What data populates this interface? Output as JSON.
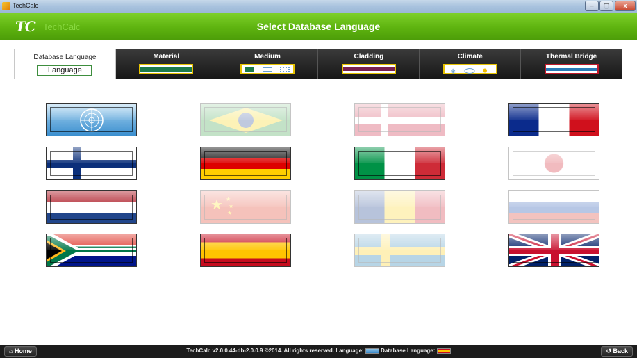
{
  "window": {
    "title": "TechCalc",
    "buttons": {
      "minimize": "–",
      "maximize": "▢",
      "close": "x"
    }
  },
  "app_header": {
    "logo": "TC",
    "brand": "TechCalc",
    "heading": "Select Database Language"
  },
  "tabs": [
    {
      "label": "Database Language",
      "glyph_text": "Language",
      "active": true
    },
    {
      "label": "Material",
      "active": false
    },
    {
      "label": "Medium",
      "active": false
    },
    {
      "label": "Cladding",
      "active": false
    },
    {
      "label": "Climate",
      "active": false
    },
    {
      "label": "Thermal Bridge",
      "active": false
    }
  ],
  "flags": [
    {
      "name": "united-nations",
      "available": true
    },
    {
      "name": "brazil",
      "available": false
    },
    {
      "name": "denmark",
      "available": false
    },
    {
      "name": "france",
      "available": true
    },
    {
      "name": "finland",
      "available": true
    },
    {
      "name": "germany",
      "available": true
    },
    {
      "name": "italy",
      "available": true
    },
    {
      "name": "japan",
      "available": false
    },
    {
      "name": "netherlands",
      "available": true
    },
    {
      "name": "china",
      "available": false
    },
    {
      "name": "romania",
      "available": false
    },
    {
      "name": "russia",
      "available": false
    },
    {
      "name": "south-africa",
      "available": true
    },
    {
      "name": "spain",
      "available": true
    },
    {
      "name": "sweden",
      "available": false
    },
    {
      "name": "united-kingdom",
      "available": true
    }
  ],
  "footer": {
    "home_label": "Home",
    "back_label": "Back",
    "status_prefix": "TechCalc v2.0.0.44-db-2.0.0.9 ©2014. All rights reserved. Language:",
    "status_db_label": "Database Language:"
  },
  "colors": {
    "header_green": "#5eb30f",
    "tab_dark": "#1f1f1f",
    "footer": "#1c1c1c"
  }
}
